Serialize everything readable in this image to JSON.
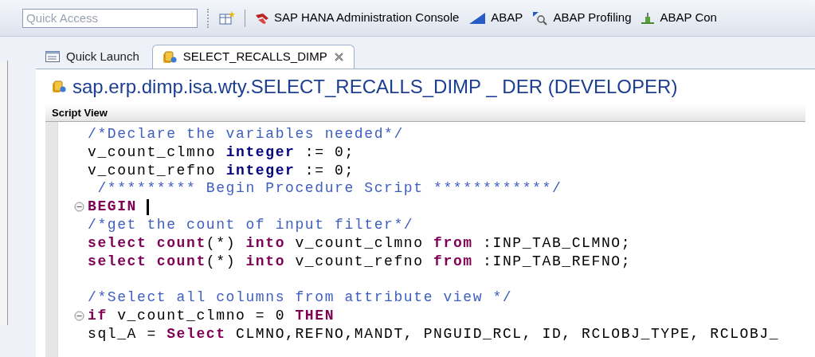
{
  "toolbar": {
    "quick_access": {
      "placeholder": "Quick Access"
    },
    "items": [
      {
        "label": "SAP HANA Administration Console"
      },
      {
        "label": "ABAP"
      },
      {
        "label": "ABAP Profiling"
      },
      {
        "label": "ABAP Con"
      }
    ]
  },
  "tabs": [
    {
      "label": "Quick Launch",
      "selected": false,
      "closable": false
    },
    {
      "label": "SELECT_RECALLS_DIMP",
      "selected": true,
      "closable": true
    }
  ],
  "editor": {
    "title": "sap.erp.dimp.isa.wty.SELECT_RECALLS_DIMP _ DER (DEVELOPER)",
    "section": "Script View",
    "lines": [
      {
        "fold": false,
        "cursor": false,
        "tokens": [
          {
            "kind": "comment",
            "text": "/*Declare the variables needed*/"
          }
        ]
      },
      {
        "fold": false,
        "cursor": false,
        "tokens": [
          {
            "kind": "plain",
            "text": "v_count_clmno "
          },
          {
            "kind": "type",
            "text": "integer"
          },
          {
            "kind": "plain",
            "text": " := 0;"
          }
        ]
      },
      {
        "fold": false,
        "cursor": false,
        "tokens": [
          {
            "kind": "plain",
            "text": "v_count_refno "
          },
          {
            "kind": "type",
            "text": "integer"
          },
          {
            "kind": "plain",
            "text": " := 0;"
          }
        ]
      },
      {
        "fold": false,
        "cursor": false,
        "tokens": [
          {
            "kind": "comment",
            "text": " /********* Begin Procedure Script ************/"
          }
        ]
      },
      {
        "fold": true,
        "cursor": true,
        "tokens": [
          {
            "kind": "keyword",
            "text": "BEGIN"
          }
        ]
      },
      {
        "fold": false,
        "cursor": false,
        "tokens": [
          {
            "kind": "comment",
            "text": "/*get the count of input filter*/"
          }
        ]
      },
      {
        "fold": false,
        "cursor": false,
        "tokens": [
          {
            "kind": "keyword",
            "text": "select count"
          },
          {
            "kind": "plain",
            "text": "(*) "
          },
          {
            "kind": "keyword",
            "text": "into"
          },
          {
            "kind": "plain",
            "text": " v_count_clmno "
          },
          {
            "kind": "keyword",
            "text": "from"
          },
          {
            "kind": "plain",
            "text": " :INP_TAB_CLMNO;"
          }
        ]
      },
      {
        "fold": false,
        "cursor": false,
        "tokens": [
          {
            "kind": "keyword",
            "text": "select count"
          },
          {
            "kind": "plain",
            "text": "(*) "
          },
          {
            "kind": "keyword",
            "text": "into"
          },
          {
            "kind": "plain",
            "text": " v_count_refno "
          },
          {
            "kind": "keyword",
            "text": "from"
          },
          {
            "kind": "plain",
            "text": " :INP_TAB_REFNO;"
          }
        ]
      },
      {
        "fold": false,
        "cursor": false
      },
      {
        "fold": false,
        "cursor": false,
        "tokens": [
          {
            "kind": "comment",
            "text": "/*Select all columns from attribute view */"
          }
        ]
      },
      {
        "fold": true,
        "cursor": false,
        "tokens": [
          {
            "kind": "keyword",
            "text": "if"
          },
          {
            "kind": "plain",
            "text": " v_count_clmno = 0 "
          },
          {
            "kind": "keyword",
            "text": "THEN"
          }
        ]
      },
      {
        "fold": false,
        "cursor": false,
        "tokens": [
          {
            "kind": "plain",
            "text": "sql_A = "
          },
          {
            "kind": "keyword",
            "text": "Select"
          },
          {
            "kind": "plain",
            "text": " CLMNO,REFNO,MANDT, PNGUID_RCL, ID, RCLOBJ_TYPE, RCLOBJ_"
          }
        ]
      }
    ]
  }
}
